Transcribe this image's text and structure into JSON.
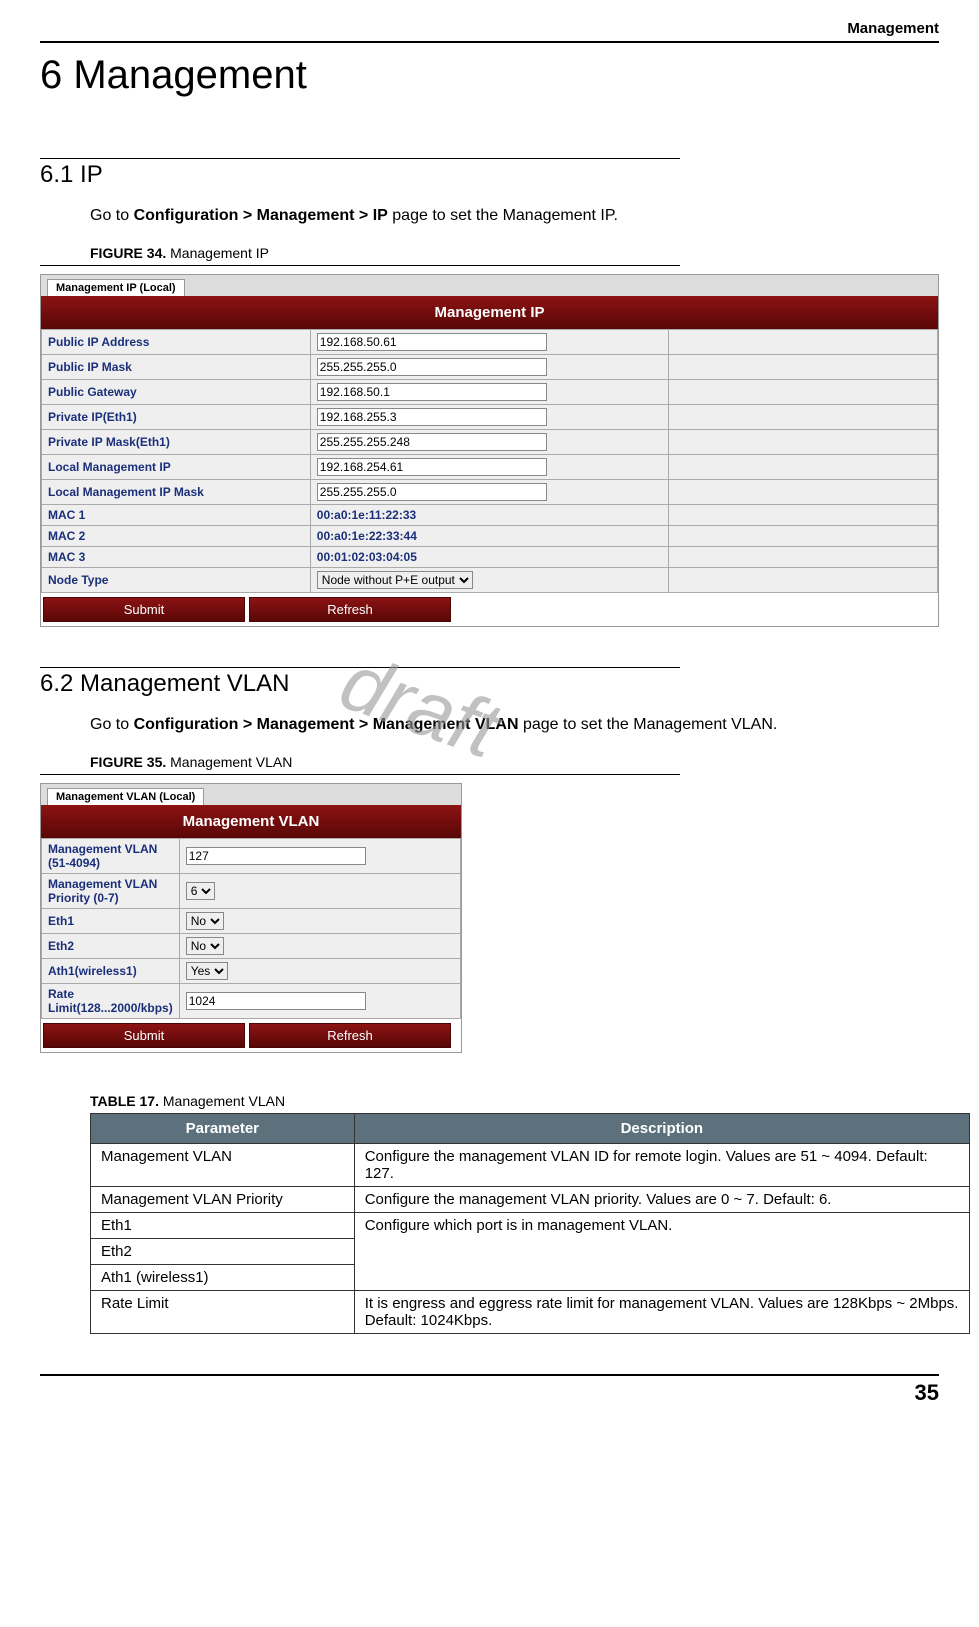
{
  "header": {
    "running": "Management"
  },
  "chapter": {
    "title": "6 Management"
  },
  "section_ip": {
    "heading": "6.1 IP",
    "instr_pre": "Go to ",
    "instr_bold": "Configuration > Management > IP",
    "instr_post": " page to set the Management IP.",
    "fig_label_strong": "FIGURE 34.",
    "fig_label_rest": " Management IP"
  },
  "fig34": {
    "tab": "Management IP (Local)",
    "banner": "Management IP",
    "rows": [
      {
        "label": "Public IP Address",
        "value": "192.168.50.61",
        "type": "text"
      },
      {
        "label": "Public IP Mask",
        "value": "255.255.255.0",
        "type": "text"
      },
      {
        "label": "Public Gateway",
        "value": "192.168.50.1",
        "type": "text"
      },
      {
        "label": "Private IP(Eth1)",
        "value": "192.168.255.3",
        "type": "text"
      },
      {
        "label": "Private IP Mask(Eth1)",
        "value": "255.255.255.248",
        "type": "text"
      },
      {
        "label": "Local Management IP",
        "value": "192.168.254.61",
        "type": "text"
      },
      {
        "label": "Local Management IP Mask",
        "value": "255.255.255.0",
        "type": "text"
      },
      {
        "label": "MAC 1",
        "value": "00:a0:1e:11:22:33",
        "type": "readonly"
      },
      {
        "label": "MAC 2",
        "value": "00:a0:1e:22:33:44",
        "type": "readonly"
      },
      {
        "label": "MAC 3",
        "value": "00:01:02:03:04:05",
        "type": "readonly"
      },
      {
        "label": "Node Type",
        "value": "Node without P+E output",
        "type": "select"
      }
    ],
    "buttons": {
      "submit": "Submit",
      "refresh": "Refresh"
    }
  },
  "section_vlan": {
    "heading": "6.2 Management VLAN",
    "instr_pre": "Go to ",
    "instr_bold": "Configuration > Management > Management VLAN",
    "instr_post": " page to set the Management VLAN.",
    "fig_label_strong": "FIGURE 35.",
    "fig_label_rest": " Management VLAN"
  },
  "fig35": {
    "tab": "Management VLAN (Local)",
    "banner": "Management VLAN",
    "rows": [
      {
        "label": "Management VLAN (51-4094)",
        "value": "127",
        "type": "text"
      },
      {
        "label": "Management VLAN Priority (0-7)",
        "value": "6",
        "type": "select"
      },
      {
        "label": "Eth1",
        "value": "No",
        "type": "select"
      },
      {
        "label": "Eth2",
        "value": "No",
        "type": "select"
      },
      {
        "label": "Ath1(wireless1)",
        "value": "Yes",
        "type": "select"
      },
      {
        "label": "Rate Limit(128...2000/kbps)",
        "value": "1024",
        "type": "text"
      }
    ],
    "buttons": {
      "submit": "Submit",
      "refresh": "Refresh"
    }
  },
  "table17": {
    "label_strong": "TABLE 17.",
    "label_rest": " Management VLAN",
    "head": {
      "param": "Parameter",
      "desc": "Description"
    },
    "rows": [
      {
        "param": "Management VLAN",
        "desc": "Configure the management VLAN ID for remote login. Values are 51 ~ 4094. Default: 127."
      },
      {
        "param": "Management VLAN Priority",
        "desc": "Configure the management VLAN priority. Values are 0 ~ 7. Default: 6."
      },
      {
        "param": "Eth1",
        "desc": "Configure which port is in management VLAN.",
        "rowspan": 3
      },
      {
        "param": "Eth2"
      },
      {
        "param": "Ath1 (wireless1)"
      },
      {
        "param": "Rate Limit",
        "desc": "It is engress and eggress rate limit for management VLAN. Values are 128Kbps ~ 2Mbps. Default: 1024Kbps."
      }
    ]
  },
  "watermark": "draft",
  "page_number": "35"
}
